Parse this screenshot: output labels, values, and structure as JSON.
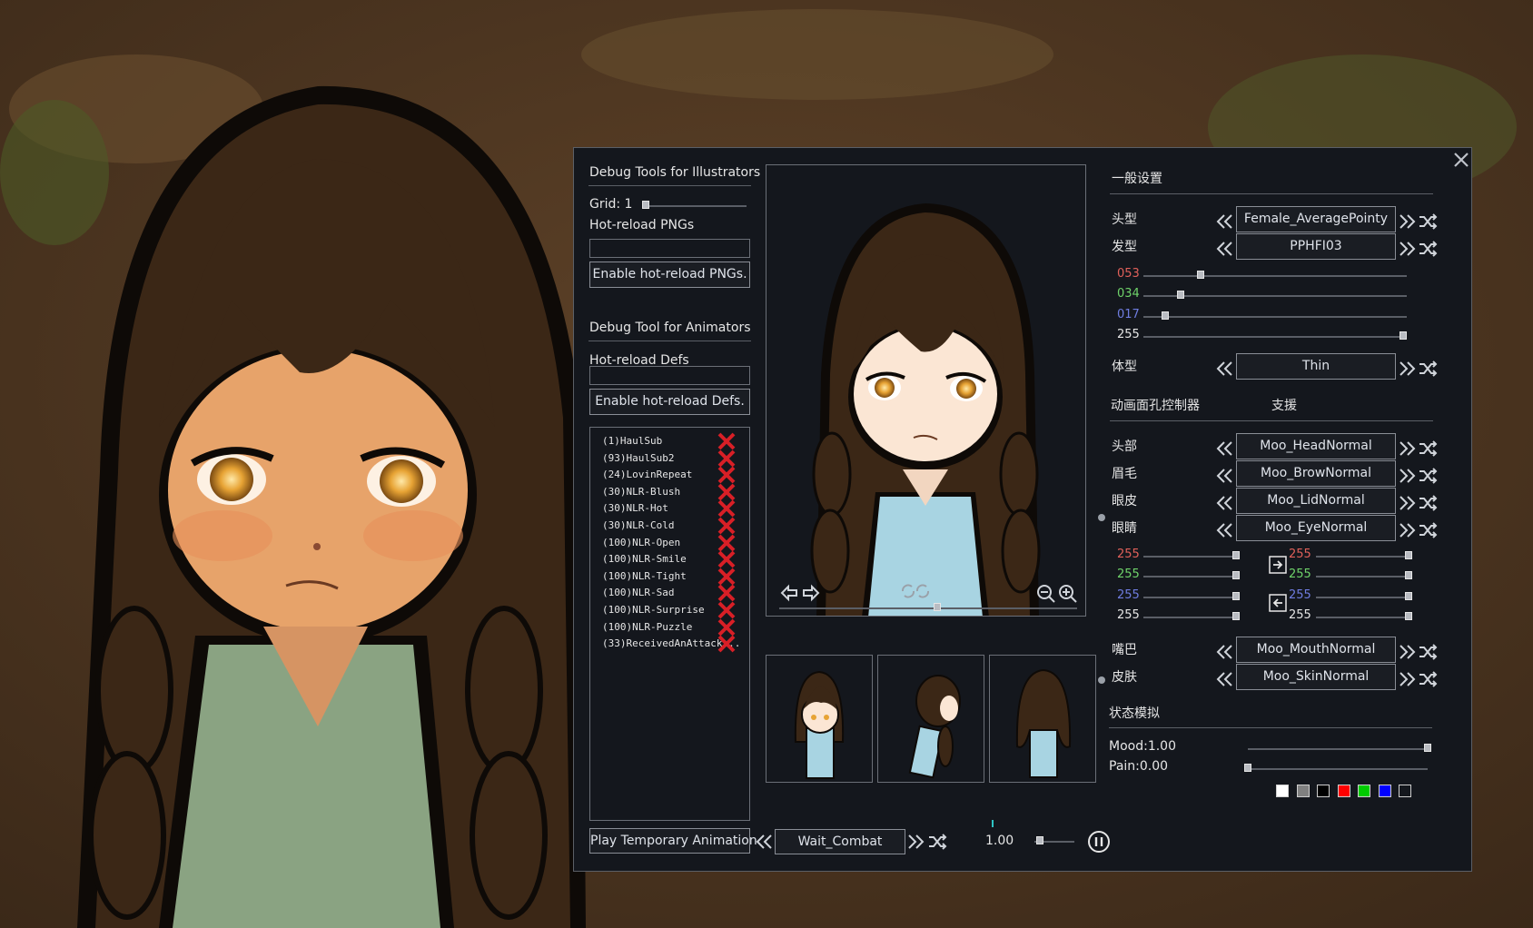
{
  "illustrators": {
    "title": "Debug Tools for Illustrators",
    "grid_label": "Grid: 1",
    "grid_value": 0,
    "hot_png_label": "Hot-reload PNGs",
    "hot_png_input": "",
    "hot_png_button": "Enable hot-reload PNGs."
  },
  "animators": {
    "title": "Debug Tool for Animators",
    "hot_defs_label": "Hot-reload Defs",
    "hot_defs_input": "",
    "hot_defs_button": "Enable hot-reload Defs.",
    "list": [
      "(1)HaulSub",
      "(93)HaulSub2",
      "(24)LovinRepeat",
      "(30)NLR-Blush",
      "(30)NLR-Hot",
      "(30)NLR-Cold",
      "(100)NLR-Open",
      "(100)NLR-Smile",
      "(100)NLR-Tight",
      "(100)NLR-Sad",
      "(100)NLR-Surprise",
      "(100)NLR-Puzzle",
      "(33)ReceivedAnAttack..."
    ]
  },
  "bottom": {
    "play_button": "Play Temporary Animation",
    "animation_value": "Wait_Combat",
    "speed_label": "1.00",
    "speed_value": 0.05
  },
  "general": {
    "title": "一般设置",
    "head_label": "头型",
    "head_value": "Female_AveragePointy",
    "hair_label": "发型",
    "hair_value": "PPHFI03",
    "hair_color": {
      "r": "053",
      "g": "034",
      "b": "017",
      "a": "255",
      "r_frac": 0.21,
      "g_frac": 0.13,
      "b_frac": 0.07,
      "a_frac": 1.0
    },
    "body_label": "体型",
    "body_value": "Thin"
  },
  "face": {
    "title": "动画面孔控制器",
    "support": "支援",
    "head_label": "头部",
    "head_value": "Moo_HeadNormal",
    "brow_label": "眉毛",
    "brow_value": "Moo_BrowNormal",
    "lid_label": "眼皮",
    "lid_value": "Moo_LidNormal",
    "eye_label": "眼睛",
    "eye_value": "Moo_EyeNormal",
    "left_color": [
      "255",
      "255",
      "255",
      "255"
    ],
    "right_color": [
      "255",
      "255",
      "255",
      "255"
    ],
    "mouth_label": "嘴巴",
    "mouth_value": "Moo_MouthNormal",
    "skin_label": "皮肤",
    "skin_value": "Moo_SkinNormal"
  },
  "state": {
    "title": "状态模拟",
    "mood_label": "Mood:1.00",
    "mood_value": 1.0,
    "pain_label": "Pain:0.00",
    "pain_value": 0.0
  },
  "colors": {
    "red_text": "#e0605a",
    "green_text": "#6fd36a",
    "blue_text": "#6f7de0",
    "x_red": "#d81f26",
    "swatches": [
      "#ffffff",
      "#808080",
      "#000000",
      "#ff0000",
      "#00cc00",
      "#0000ff",
      "#14171d"
    ]
  }
}
